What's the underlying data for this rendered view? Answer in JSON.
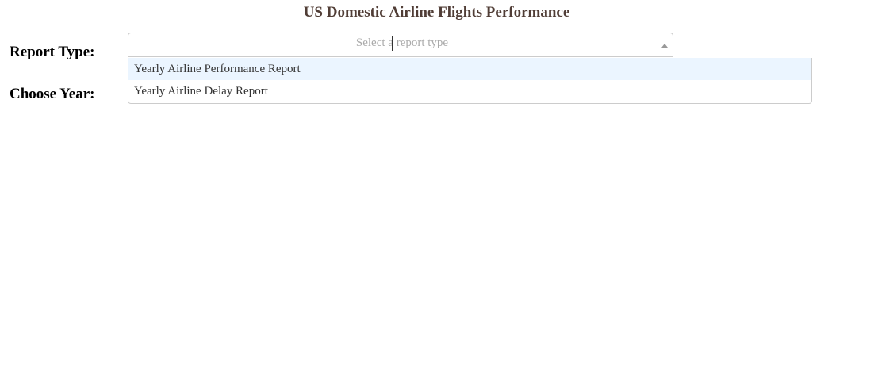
{
  "header": {
    "title": "US Domestic Airline Flights Performance"
  },
  "form": {
    "report_type_label": "Report Type:",
    "choose_year_label": "Choose Year:",
    "report_type_select": {
      "placeholder": "Select a report type",
      "options": [
        {
          "label": "Yearly Airline Performance Report",
          "focused": true
        },
        {
          "label": "Yearly Airline Delay Report",
          "focused": false
        }
      ]
    }
  },
  "colors": {
    "title": "#503D36",
    "option_highlight": "#ebf5ff"
  }
}
